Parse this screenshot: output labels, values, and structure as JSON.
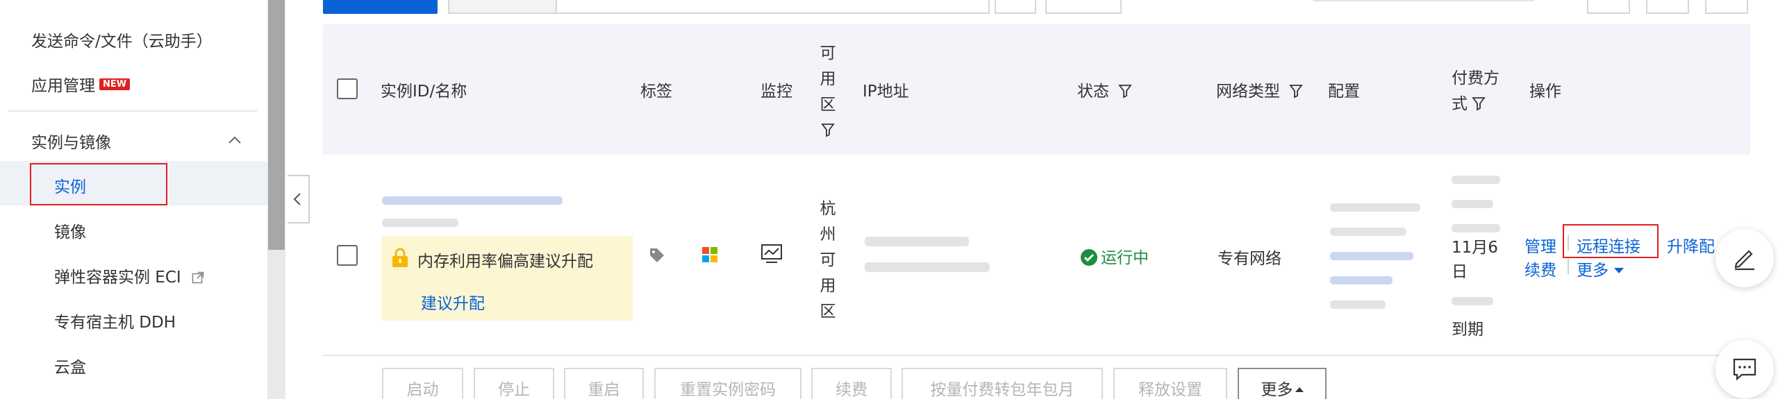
{
  "sidebar": {
    "items": [
      {
        "label": "发送命令/文件（云助手）"
      },
      {
        "label": "应用管理",
        "badge": "NEW"
      },
      {
        "label": "实例与镜像"
      },
      {
        "label": "实例"
      },
      {
        "label": "镜像"
      },
      {
        "label": "弹性容器实例 ECI"
      },
      {
        "label": "专有宿主机 DDH"
      },
      {
        "label": "云盒"
      }
    ]
  },
  "table": {
    "headers": {
      "instance": "实例ID/名称",
      "tags": "标签",
      "monitor": "监控",
      "zone_chars": [
        "可",
        "用",
        "区"
      ],
      "ip": "IP地址",
      "status": "状态",
      "network": "网络类型",
      "config": "配置",
      "billing_line1": "付费方",
      "billing_line2": "式",
      "actions": "操作"
    },
    "row": {
      "tip_text": "内存利用率偏高建议升配",
      "tip_link": "建议升配",
      "zone_chars": [
        "杭",
        "州",
        "可",
        "用",
        "区"
      ],
      "status": "运行中",
      "network": "专有网络",
      "billing_day": "11月6",
      "billing_day2": "日",
      "billing_expire": "到期",
      "actions": {
        "manage": "管理",
        "remote": "远程连接",
        "resize": "升降配",
        "renew": "续费",
        "more": "更多"
      }
    }
  },
  "bottom_actions": [
    "启动",
    "停止",
    "重启",
    "重置实例密码",
    "续费",
    "按量付费转包年包月",
    "释放设置",
    "更多"
  ],
  "colors": {
    "link": "#0a63d6",
    "highlight": "#e02020",
    "running": "#1e8e3e"
  }
}
